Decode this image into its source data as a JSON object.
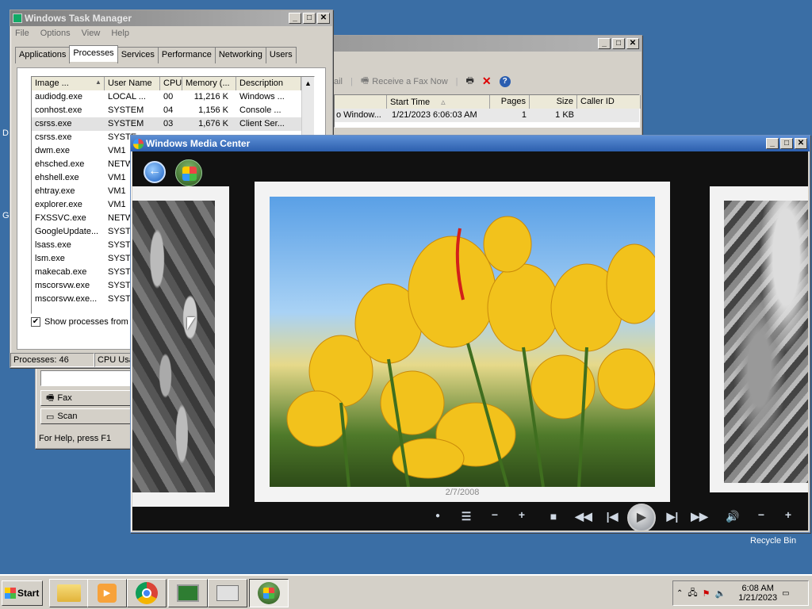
{
  "desktop": {
    "recycle_bin_label": "Recycle Bin",
    "left_edge_labels": [
      "D",
      "G"
    ]
  },
  "task_manager": {
    "title": "Windows Task Manager",
    "menu": [
      "File",
      "Options",
      "View",
      "Help"
    ],
    "tabs": [
      "Applications",
      "Processes",
      "Services",
      "Performance",
      "Networking",
      "Users"
    ],
    "selected_tab": "Processes",
    "columns": [
      "Image ...",
      "User Name",
      "CPU",
      "Memory (...",
      "Description"
    ],
    "rows": [
      [
        "audiodg.exe",
        "LOCAL ...",
        "00",
        "11,216 K",
        "Windows ..."
      ],
      [
        "conhost.exe",
        "SYSTEM",
        "04",
        "1,156 K",
        "Console ..."
      ],
      [
        "csrss.exe",
        "SYSTEM",
        "03",
        "1,676 K",
        "Client Ser..."
      ],
      [
        "csrss.exe",
        "SYSTE",
        "",
        "",
        ""
      ],
      [
        "dwm.exe",
        "VM1",
        "",
        "",
        ""
      ],
      [
        "ehsched.exe",
        "NETW",
        "",
        "",
        ""
      ],
      [
        "ehshell.exe",
        "VM1",
        "",
        "",
        ""
      ],
      [
        "ehtray.exe",
        "VM1",
        "",
        "",
        ""
      ],
      [
        "explorer.exe",
        "VM1",
        "",
        "",
        ""
      ],
      [
        "FXSSVC.exe",
        "NETW",
        "",
        "",
        ""
      ],
      [
        "GoogleUpdate...",
        "SYSTE",
        "",
        "",
        ""
      ],
      [
        "lsass.exe",
        "SYSTE",
        "",
        "",
        ""
      ],
      [
        "lsm.exe",
        "SYSTE",
        "",
        "",
        ""
      ],
      [
        "makecab.exe",
        "SYSTE",
        "",
        "",
        ""
      ],
      [
        "mscorsvw.exe",
        "SYSTE",
        "",
        "",
        ""
      ],
      [
        "mscorsvw.exe...",
        "SYSTE",
        "",
        "",
        ""
      ]
    ],
    "selected_row_index": 2,
    "show_all_label": "Show processes from a",
    "show_all_checked": true,
    "status_processes": "Processes: 46",
    "status_cpu": "CPU Usa"
  },
  "fax_window": {
    "toolbar_left": "ail",
    "receive_fax_label": "Receive a Fax Now",
    "columns": [
      "",
      "Start Time",
      "Pages",
      "Size",
      "Caller ID"
    ],
    "row": [
      "o Window...",
      "1/21/2023 6:06:03 AM",
      "1",
      "1 KB",
      ""
    ],
    "nav_fax": "Fax",
    "nav_scan": "Scan",
    "status": "For Help, press F1"
  },
  "media_center": {
    "title": "Windows Media Center",
    "photo_date": "2/7/2008",
    "controls": [
      "record-dot",
      "list",
      "minus",
      "plus",
      "stop",
      "rewind",
      "previous",
      "play",
      "next",
      "fast-forward",
      "volume",
      "volume-minus",
      "volume-plus"
    ]
  },
  "taskbar": {
    "start_label": "Start",
    "clock_time": "6:08 AM",
    "clock_date": "1/21/2023",
    "active_app": "Windows Media Center"
  },
  "colors": {
    "desktop": "#3a6ea5",
    "accent_blue": "#0a246a",
    "media_center_bg": "#111111"
  }
}
